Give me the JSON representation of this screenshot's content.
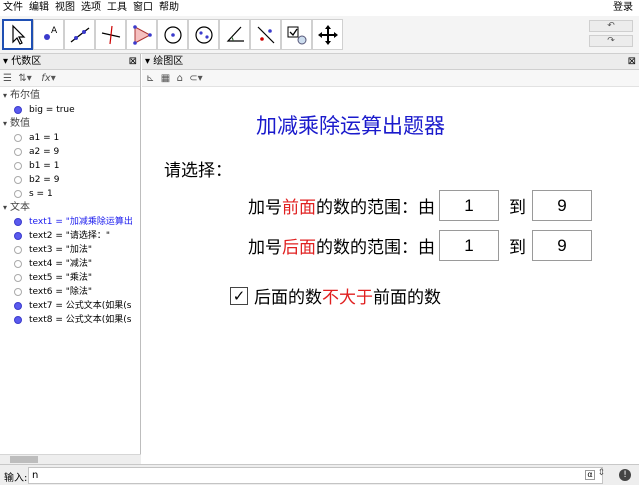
{
  "menu": {
    "items": [
      "文件",
      "编辑",
      "视图",
      "选项",
      "工具",
      "窗口",
      "帮助"
    ],
    "login": "登录"
  },
  "toolbar": {
    "tools": [
      "move-tool",
      "point-tool",
      "line-tool",
      "perpendicular-line-tool",
      "polygon-tool",
      "circle-tool",
      "ellipse-tool",
      "angle-tool",
      "reflect-tool",
      "checkbox-tool",
      "move-graphics-view-tool"
    ],
    "active_index": 0
  },
  "algebra": {
    "title": "代数区",
    "groups": [
      {
        "label": "布尔值",
        "items": [
          {
            "text": "big = true",
            "on": true,
            "blue": false
          }
        ]
      },
      {
        "label": "数值",
        "items": [
          {
            "text": "a1 = 1",
            "on": false,
            "blue": false
          },
          {
            "text": "a2 = 9",
            "on": false,
            "blue": false
          },
          {
            "text": "b1 = 1",
            "on": false,
            "blue": false
          },
          {
            "text": "b2 = 9",
            "on": false,
            "blue": false
          },
          {
            "text": "s = 1",
            "on": false,
            "blue": false
          }
        ]
      },
      {
        "label": "文本",
        "items": [
          {
            "text": "text1 = \"加减乘除运算出",
            "on": true,
            "blue": true
          },
          {
            "text": "text2 = \"请选择：\"",
            "on": true,
            "blue": false
          },
          {
            "text": "text3 = \"加法\"",
            "on": false,
            "blue": false
          },
          {
            "text": "text4 = \"减法\"",
            "on": false,
            "blue": false
          },
          {
            "text": "text5 = \"乘法\"",
            "on": false,
            "blue": false
          },
          {
            "text": "text6 = \"除法\"",
            "on": false,
            "blue": false
          },
          {
            "text": "text7 = 公式文本(如果(s",
            "on": true,
            "blue": false
          },
          {
            "text": "text8 = 公式文本(如果(s",
            "on": true,
            "blue": false
          }
        ]
      }
    ]
  },
  "graphics": {
    "title": "绘图区",
    "heading": "加减乘除运算出题器",
    "prompt": "请选择：",
    "row1": {
      "prefix": "加号",
      "highlight": "前面",
      "suffix": "的数的范围：由",
      "from": "1",
      "to_label": "到",
      "to": "9"
    },
    "row2": {
      "prefix": "加号",
      "highlight": "后面",
      "suffix": "的数的范围：由",
      "from": "1",
      "to_label": "到",
      "to": "9"
    },
    "checkbox": {
      "checked": true,
      "pre": "后面的数",
      "highlight": "不大于",
      "post": "前面的数"
    }
  },
  "inputbar": {
    "label": "输入:",
    "value": "n",
    "alpha": "α",
    "help": "!"
  },
  "colors": {
    "heading": "#1a1acc",
    "highlight": "#e02020",
    "active_tool_border": "#1f4fb3"
  }
}
